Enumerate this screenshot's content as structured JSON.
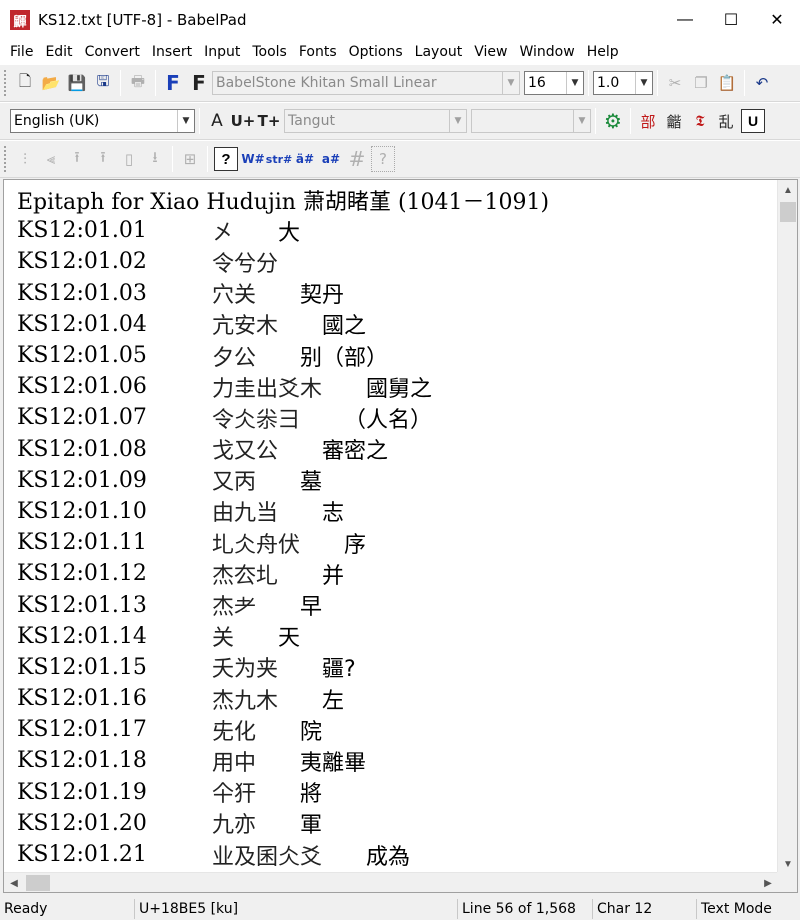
{
  "window": {
    "title": "KS12.txt [UTF-8] - BabelPad",
    "app_icon_glyph": "鼲"
  },
  "menu": [
    "File",
    "Edit",
    "Convert",
    "Insert",
    "Input",
    "Tools",
    "Fonts",
    "Options",
    "Layout",
    "View",
    "Window",
    "Help"
  ],
  "toolbar1": {
    "font_name": "BabelStone Khitan Small Linear",
    "font_size": "16",
    "line_spacing": "1.0"
  },
  "toolbar2": {
    "language": "English (UK)",
    "script": "Tangut",
    "script2": "",
    "buttons": [
      "A",
      "U+",
      "T+"
    ],
    "cjk_buttons": [
      "部",
      "龤",
      "𝕿",
      "乱",
      "U"
    ]
  },
  "toolbar3": {
    "buttons": [
      "?",
      "W#",
      "str#",
      "ä#",
      "a#",
      "#",
      "?"
    ]
  },
  "editor": {
    "heading": "Epitaph for Xiao Hudujin 萧胡睹堇 (1041－1091)",
    "lines": [
      {
        "code": "KS12:01.01",
        "khitan": "㐅",
        "han": "大",
        "gap": 60
      },
      {
        "code": "KS12:01.02",
        "khitan": "令兮分",
        "han": "",
        "gap": 0
      },
      {
        "code": "KS12:01.03",
        "khitan": "穴关",
        "han": "契丹",
        "gap": 64
      },
      {
        "code": "KS12:01.04",
        "khitan": "亢安木",
        "han": "國之",
        "gap": 64
      },
      {
        "code": "KS12:01.05",
        "khitan": "夕公",
        "han": "别（部）",
        "gap": 64
      },
      {
        "code": "KS12:01.06",
        "khitan": "力圭出爻木",
        "han": "國舅之",
        "gap": 64
      },
      {
        "code": "KS12:01.07",
        "khitan": "令仌尜彐",
        "han": "（人名）",
        "gap": 64
      },
      {
        "code": "KS12:01.08",
        "khitan": "戈又公",
        "han": "審密之",
        "gap": 64
      },
      {
        "code": "KS12:01.09",
        "khitan": "又丙",
        "han": "墓",
        "gap": 64
      },
      {
        "code": "KS12:01.10",
        "khitan": "由九当",
        "han": "志",
        "gap": 64
      },
      {
        "code": "KS12:01.11",
        "khitan": "圠仌舟伏",
        "han": "序",
        "gap": 64
      },
      {
        "code": "KS12:01.12",
        "khitan": "杰厺圠",
        "han": "并",
        "gap": 64
      },
      {
        "code": "KS12:01.13",
        "khitan": "杰耂",
        "han": "早",
        "gap": 64
      },
      {
        "code": "KS12:01.14",
        "khitan": "关",
        "han": "天",
        "gap": 64
      },
      {
        "code": "KS12:01.15",
        "khitan": "夭为夹",
        "han": "疆?",
        "gap": 64
      },
      {
        "code": "KS12:01.16",
        "khitan": "杰九木",
        "han": "左",
        "gap": 64
      },
      {
        "code": "KS12:01.17",
        "khitan": "兂化",
        "han": "院",
        "gap": 64
      },
      {
        "code": "KS12:01.18",
        "khitan": "用中",
        "han": "夷離畢",
        "gap": 64
      },
      {
        "code": "KS12:01.19",
        "khitan": "仐犴",
        "han": "將",
        "gap": 64
      },
      {
        "code": "KS12:01.20",
        "khitan": "九亦",
        "han": "軍",
        "gap": 64
      },
      {
        "code": "KS12:01.21",
        "khitan": "业及囷仌爻",
        "han": "成為",
        "gap": 64
      }
    ]
  },
  "status": {
    "state": "Ready",
    "char_code": "U+18BE5 [ku]",
    "line": "Line 56 of 1,568",
    "char": "Char 12",
    "mode": "Text Mode"
  }
}
